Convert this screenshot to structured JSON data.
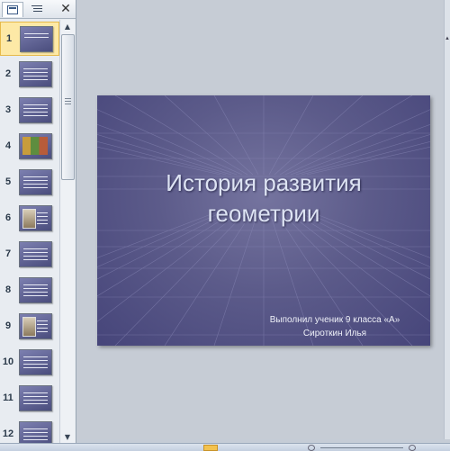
{
  "left_panel": {
    "tabs": [
      {
        "name": "slides-tab-icon"
      },
      {
        "name": "outline-tab-icon"
      }
    ],
    "close_glyph": "✕",
    "selected_slide": 1,
    "slides": [
      {
        "number": "1",
        "kind": "title"
      },
      {
        "number": "2",
        "kind": "text"
      },
      {
        "number": "3",
        "kind": "text"
      },
      {
        "number": "4",
        "kind": "collage"
      },
      {
        "number": "5",
        "kind": "text"
      },
      {
        "number": "6",
        "kind": "photo"
      },
      {
        "number": "7",
        "kind": "text"
      },
      {
        "number": "8",
        "kind": "text"
      },
      {
        "number": "9",
        "kind": "photo"
      },
      {
        "number": "10",
        "kind": "text"
      },
      {
        "number": "11",
        "kind": "text"
      },
      {
        "number": "12",
        "kind": "text"
      }
    ]
  },
  "slide": {
    "title_line1": "История развития",
    "title_line2": "геометрии",
    "subtitle_line1": "Выполнил ученик 9 класса «А»",
    "subtitle_line2": "Сироткин Илья"
  },
  "colors": {
    "slide_background": "#5c5b8a",
    "title_text": "#dde3f3",
    "selection": "#fde9a6"
  }
}
